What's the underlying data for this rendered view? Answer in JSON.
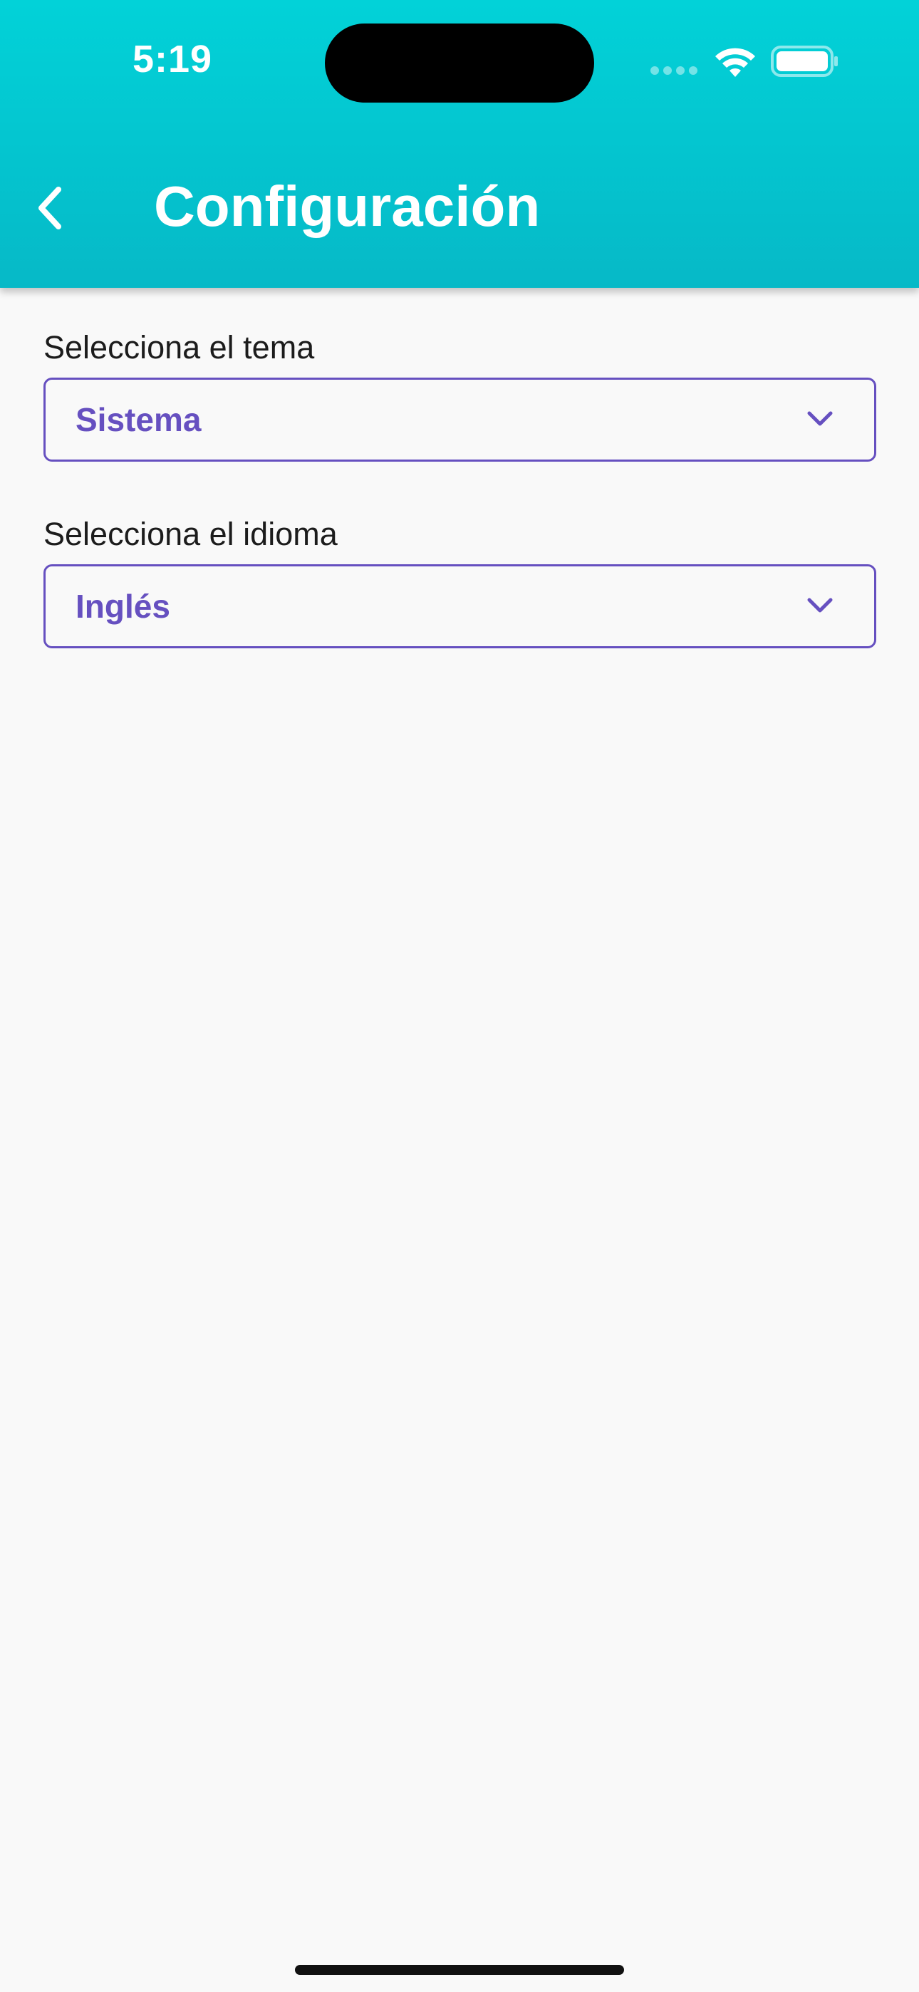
{
  "status_bar": {
    "time": "5:19",
    "icons": [
      "signal-dots-icon",
      "wifi-icon",
      "battery-icon"
    ]
  },
  "header": {
    "back_icon": "chevron-left-icon",
    "title": "Configuración"
  },
  "settings": {
    "theme": {
      "label": "Selecciona el tema",
      "selected": "Sistema"
    },
    "language": {
      "label": "Selecciona el idioma",
      "selected": "Inglés"
    }
  },
  "colors": {
    "header_gradient_top": "#02d2d8",
    "header_gradient_bottom": "#06b9c7",
    "accent": "#6650c0",
    "background": "#f9f9f9"
  }
}
